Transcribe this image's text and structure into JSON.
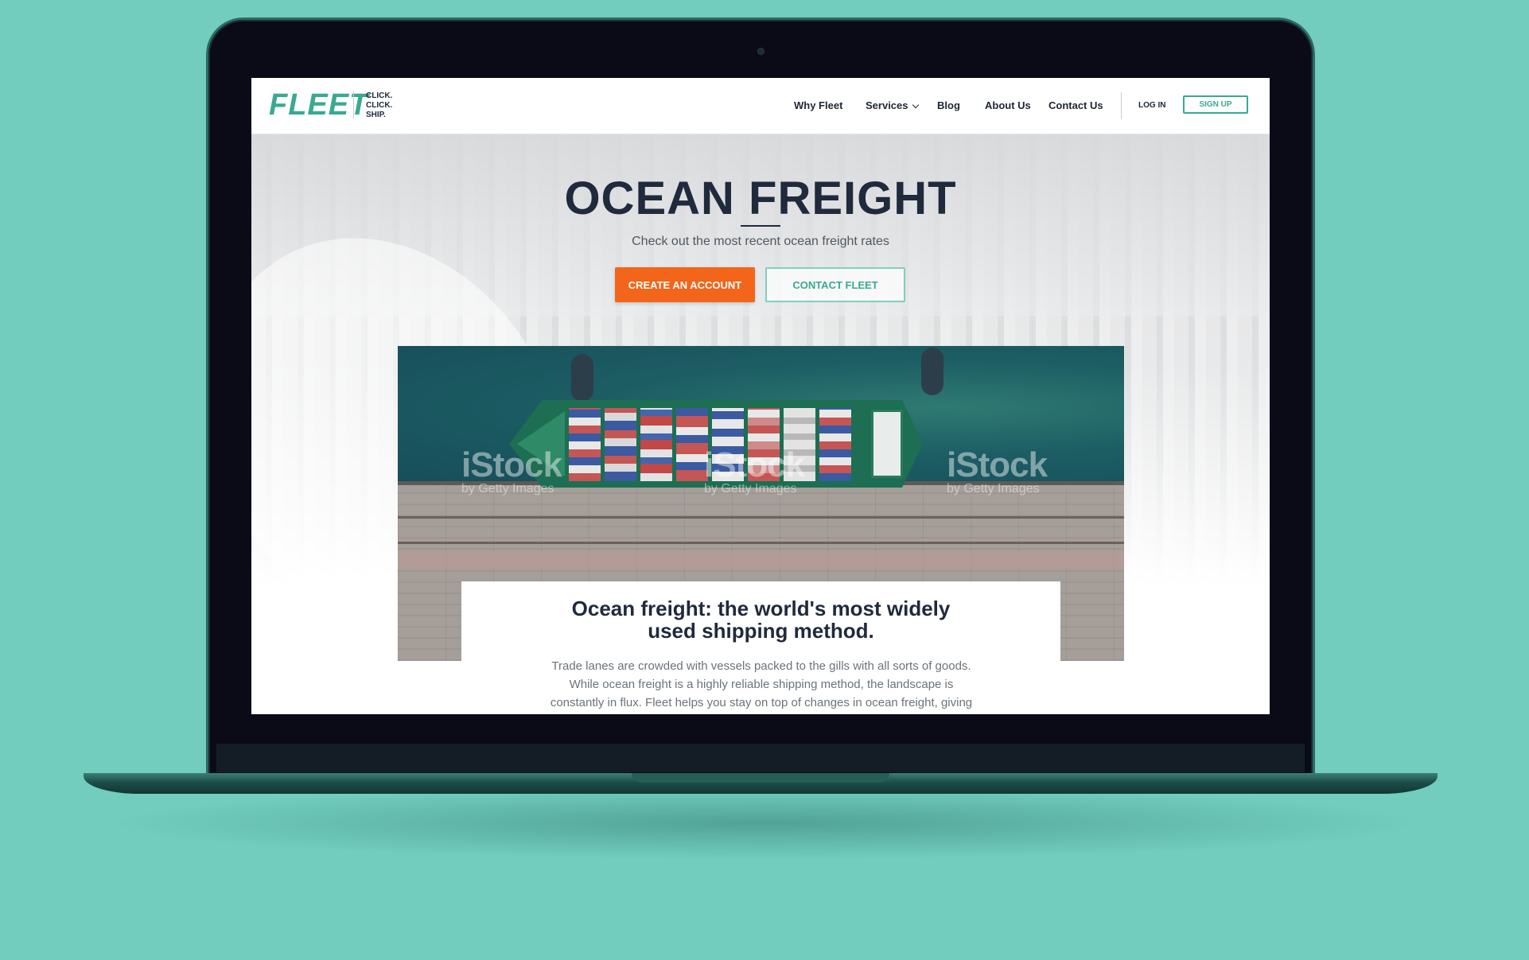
{
  "brand": {
    "logo": "FLEET",
    "tagline": [
      "CLICK.",
      "CLICK.",
      "SHIP."
    ],
    "primary_color": "#3aa992",
    "accent_color": "#f2651a",
    "background_color": "#72cdbf"
  },
  "nav": {
    "items": [
      {
        "label": "Why Fleet"
      },
      {
        "label": "Services",
        "icon": "chevron-down-icon"
      },
      {
        "label": "Blog"
      },
      {
        "label": "About Us"
      },
      {
        "label": "Contact Us"
      }
    ],
    "login_label": "LOG IN",
    "signup_label": "SIGN UP"
  },
  "hero": {
    "title": "OCEAN FREIGHT",
    "subtitle": "Check out the most recent ocean freight rates",
    "primary_button": "CREATE AN ACCOUNT",
    "secondary_button": "CONTACT FLEET"
  },
  "photo": {
    "watermark_main": "iStock",
    "watermark_sub": "by Getty Images"
  },
  "article": {
    "heading_lines": [
      "Ocean freight: the world's most widely",
      "used shipping method."
    ],
    "body_lines": [
      "Trade lanes are crowded with vessels packed to the gills with all sorts of goods.",
      "While ocean freight is a highly reliable shipping method, the landscape is",
      "constantly in flux. Fleet helps you stay on top of changes in ocean freight, giving"
    ]
  }
}
